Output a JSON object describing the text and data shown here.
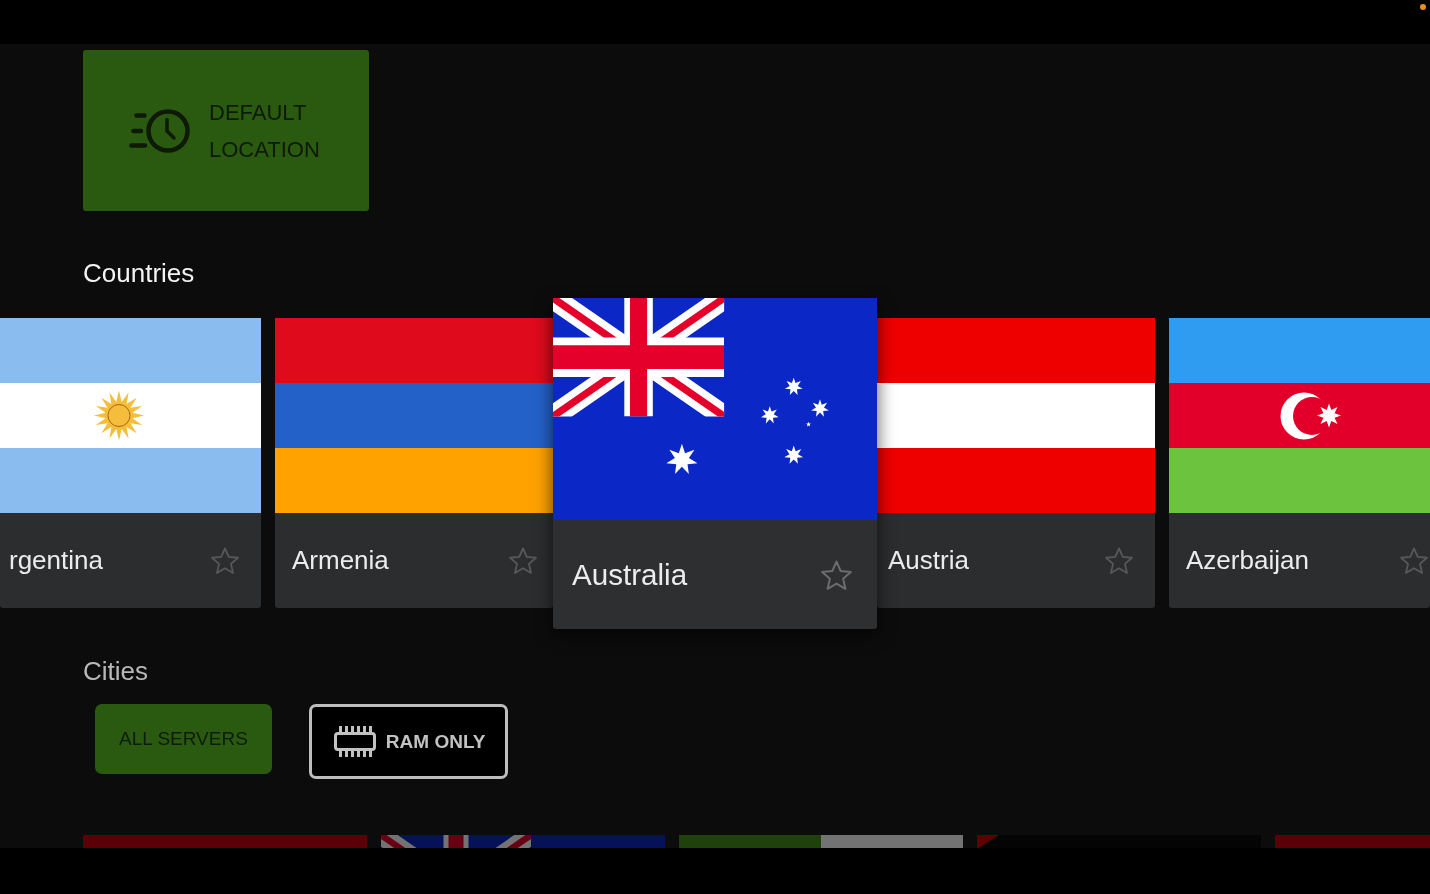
{
  "default_location_button": {
    "label": "DEFAULT LOCATION"
  },
  "countries": {
    "heading": "Countries",
    "items": [
      {
        "name": "rgentina",
        "kind": "argentina",
        "favorite": false,
        "selected": false
      },
      {
        "name": "Armenia",
        "kind": "armenia",
        "favorite": false,
        "selected": false
      },
      {
        "name": "Australia",
        "kind": "australia",
        "favorite": false,
        "selected": true
      },
      {
        "name": "Austria",
        "kind": "austria",
        "favorite": false,
        "selected": false
      },
      {
        "name": "Azerbaijan",
        "kind": "azerbaijan",
        "favorite": false,
        "selected": false
      }
    ]
  },
  "cities": {
    "heading": "Cities",
    "filters": [
      {
        "label": "ALL SERVERS",
        "kind": "text",
        "selected": true
      },
      {
        "label": "RAM ONLY",
        "kind": "icon-text",
        "selected": false
      }
    ],
    "cards": [
      {
        "kind": "red"
      },
      {
        "kind": "union-jack"
      },
      {
        "kind": "green-white"
      },
      {
        "kind": "red-corner"
      },
      {
        "kind": "red"
      }
    ]
  }
}
